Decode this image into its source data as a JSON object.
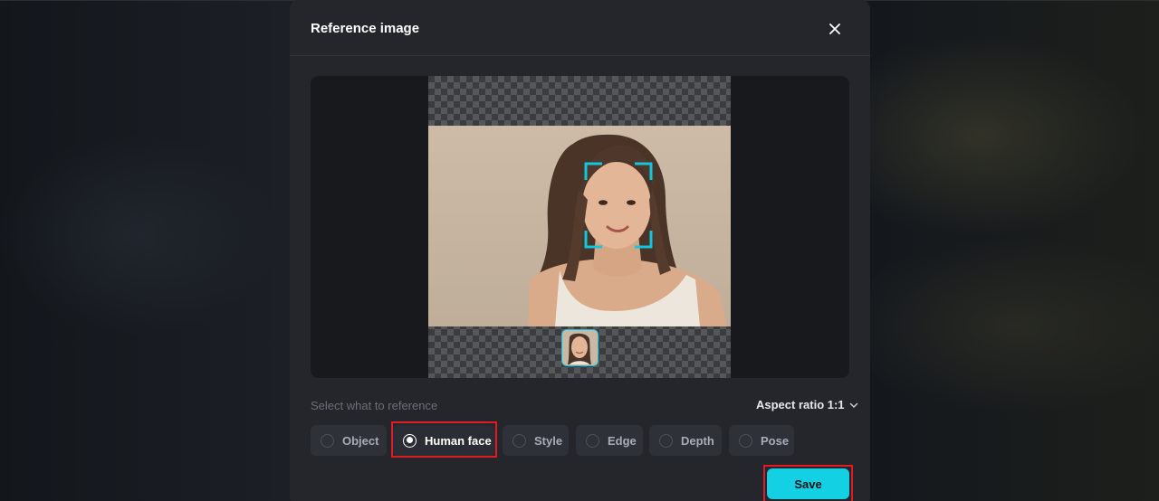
{
  "dialog": {
    "title": "Reference image",
    "close_icon": "close-icon"
  },
  "preview": {
    "image_description_icon": "portrait-photo",
    "face_detection_icon": "face-frame-icon"
  },
  "reference": {
    "label": "Select what to reference",
    "aspect_ratio_label": "Aspect ratio 1:1",
    "aspect_icon": "chevron-down-icon",
    "options": [
      {
        "label": "Object",
        "selected": false
      },
      {
        "label": "Human face",
        "selected": true
      },
      {
        "label": "Style",
        "selected": false
      },
      {
        "label": "Edge",
        "selected": false
      },
      {
        "label": "Depth",
        "selected": false
      },
      {
        "label": "Pose",
        "selected": false
      }
    ]
  },
  "actions": {
    "save_label": "Save"
  },
  "colors": {
    "accent": "#13d0e3",
    "highlight": "#e01b24",
    "dialog_bg": "#24262c"
  }
}
